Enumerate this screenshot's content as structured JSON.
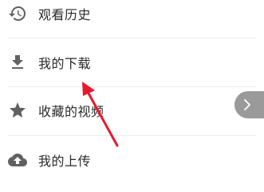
{
  "menu": {
    "items": [
      {
        "label": "观看历史",
        "icon": "history-icon"
      },
      {
        "label": "我的下载",
        "icon": "download-icon"
      },
      {
        "label": "收藏的视频",
        "icon": "star-icon"
      },
      {
        "label": "我的上传",
        "icon": "cloud-upload-icon"
      }
    ]
  },
  "floating_button": {
    "icon": "chevron-right-icon"
  },
  "annotation": {
    "icon": "red-arrow-icon",
    "color": "#e8192c"
  },
  "colors": {
    "icon": "#616161",
    "text": "#2a2a2a",
    "divider": "#ececec",
    "float_button": "#9a9a9a"
  }
}
